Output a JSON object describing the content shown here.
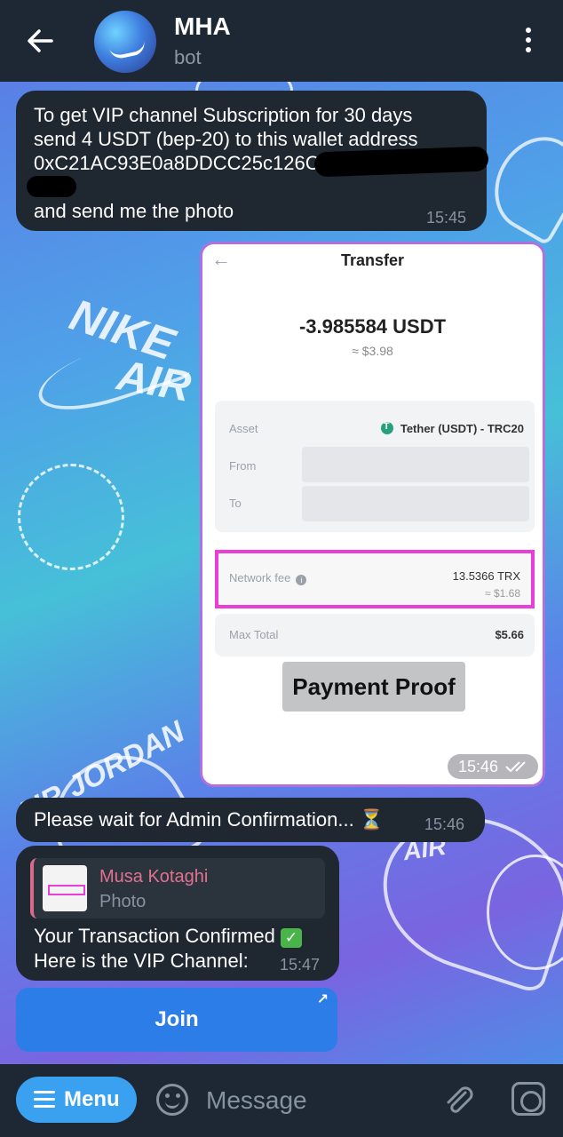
{
  "header": {
    "title": "MHA",
    "subtitle": "bot"
  },
  "messages": {
    "m1": {
      "lines": [
        "To get VIP channel Subscription for 30 days",
        "send 4 USDT (bep-20) to this wallet address",
        "0xC21AC93E0a8DDCC25c126Cf"
      ],
      "last_line": "and send me the photo",
      "time": "15:45"
    },
    "photo": {
      "title": "Transfer",
      "amount": "-3.985584 USDT",
      "amount_usd": "≈ $3.98",
      "asset_label": "Asset",
      "asset_value": "Tether (USDT) - TRC20",
      "from_label": "From",
      "to_label": "To",
      "fee_label": "Network fee",
      "fee_value": "13.5366 TRX",
      "fee_usd": "≈ $1.68",
      "max_label": "Max Total",
      "max_value": "$5.66",
      "proof_label": "Payment Proof",
      "time": "15:46",
      "status_icon": "double-check-icon"
    },
    "m3": {
      "text": "Please wait for Admin Confirmation... ⏳",
      "time": "15:46"
    },
    "m4": {
      "reply_name": "Musa Kotaghi",
      "reply_sub": "Photo",
      "line1": "Your Transaction Confirmed",
      "line2": "Here is the VIP Channel:",
      "time": "15:47"
    }
  },
  "join_button": {
    "label": "Join"
  },
  "background_text": {
    "nike": "NIKE",
    "air1": "AIR",
    "jordan": "AIR JORDAN",
    "air2": "AIR"
  },
  "input_bar": {
    "menu_label": "Menu",
    "placeholder": "Message"
  },
  "colors": {
    "bubble": "#1f2731",
    "header": "#1e2834",
    "menu_button": "#3aa0f0",
    "join_button": "#2c7de8",
    "fee_highlight": "#e83fd6"
  }
}
